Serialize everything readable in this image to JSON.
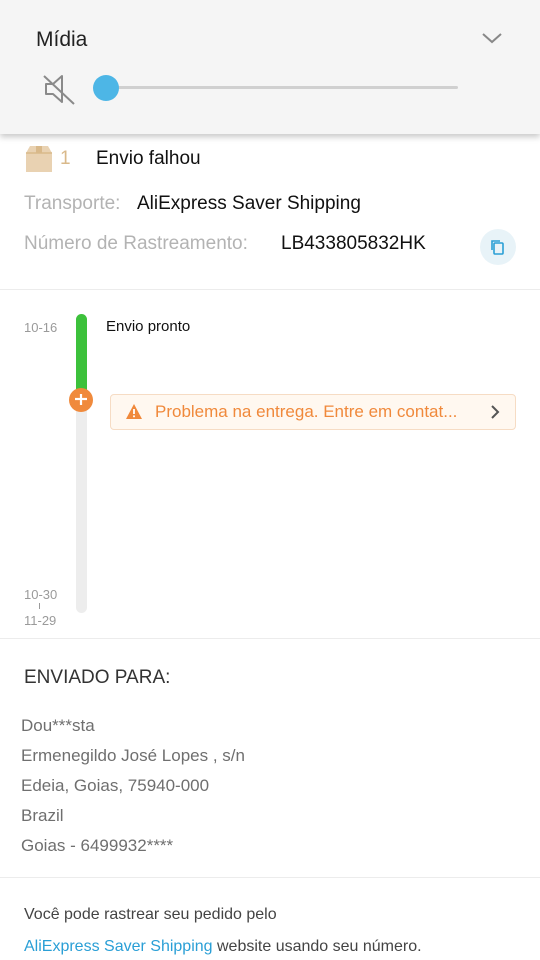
{
  "media": {
    "title": "Mídia",
    "volume_level": 0,
    "muted": true,
    "accent_color": "#4db6e6"
  },
  "order": {
    "package_count": "1",
    "status": "Envio falhou",
    "transport_label": "Transporte:",
    "transport_value": "AliExpress Saver Shipping",
    "tracking_label": "Número de Rastreamento:",
    "tracking_value": "LB433805832HK"
  },
  "timeline": {
    "date_start": "10-16",
    "date_mid": "10-30",
    "date_end": "11-29",
    "event": "Envio pronto",
    "alert": "Problema na entrega. Entre em contat...",
    "progress_color": "#3cc13b",
    "alert_color": "#f0893b"
  },
  "shipping": {
    "title": "ENVIADO PARA:",
    "lines": [
      "Dou***sta",
      "Ermenegildo José Lopes , s/n",
      "Edeia, Goias, 75940-000",
      "Brazil",
      "Goias - 6499932****"
    ]
  },
  "note": {
    "line1": "Você pode rastrear seu pedido pelo",
    "link": "AliExpress Saver Shipping",
    "line2_rest": " website usando seu número."
  }
}
